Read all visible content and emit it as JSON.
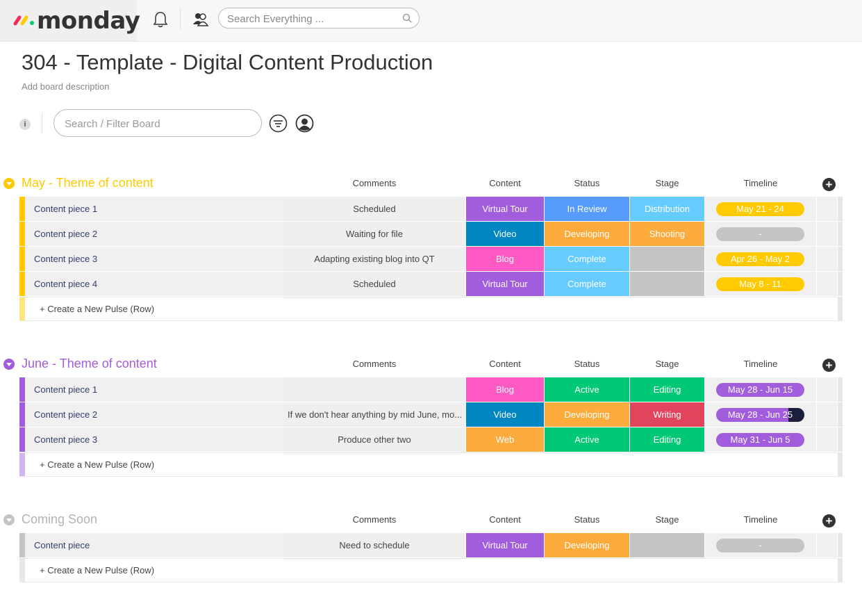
{
  "app": {
    "logo_text": "monday"
  },
  "topbar": {
    "search_placeholder": "Search Everything ..."
  },
  "board": {
    "title": "304 - Template - Digital Content Production",
    "description": "Add board description",
    "info_label": "i",
    "filter_placeholder": "Search / Filter Board"
  },
  "columns": {
    "comments": "Comments",
    "content": "Content",
    "status": "Status",
    "stage": "Stage",
    "timeline": "Timeline"
  },
  "create_row_label": "+ Create a New Pulse (Row)",
  "groups": [
    {
      "title": "May - Theme of content",
      "color": "#ffcb00",
      "rows": [
        {
          "name": "Content piece 1",
          "comment": "Scheduled",
          "content": "Virtual Tour",
          "content_color": "#a25ddc",
          "status": "In Review",
          "status_color": "#579bfc",
          "stage": "Distribution",
          "stage_color": "#66ccff",
          "timeline": "May 21 - 24",
          "timeline_color": "#ffcb00"
        },
        {
          "name": "Content piece 2",
          "comment": "Waiting for file",
          "content": "Video",
          "content_color": "#0086c0",
          "status": "Developing",
          "status_color": "#fdab3d",
          "stage": "Shooting",
          "stage_color": "#fdab3d",
          "timeline": "-",
          "timeline_color": "#c4c4c4"
        },
        {
          "name": "Content piece 3",
          "comment": "Adapting existing blog into QT",
          "content": "Blog",
          "content_color": "#ff5ac4",
          "status": "Complete",
          "status_color": "#66ccff",
          "stage": "",
          "stage_color": "#c4c4c4",
          "timeline": "Apr 26 - May 2",
          "timeline_color": "#ffcb00"
        },
        {
          "name": "Content piece 4",
          "comment": "Scheduled",
          "content": "Virtual Tour",
          "content_color": "#a25ddc",
          "status": "Complete",
          "status_color": "#66ccff",
          "stage": "",
          "stage_color": "#c4c4c4",
          "timeline": "May 8 - 11",
          "timeline_color": "#ffcb00"
        }
      ]
    },
    {
      "title": "June - Theme of content",
      "color": "#a25ddc",
      "rows": [
        {
          "name": "Content piece 1",
          "comment": "",
          "content": "Blog",
          "content_color": "#ff5ac4",
          "status": "Active",
          "status_color": "#00c875",
          "stage": "Editing",
          "stage_color": "#00c875",
          "timeline": "May 28 - Jun 15",
          "timeline_color": "#a25ddc"
        },
        {
          "name": "Content piece 2",
          "comment": "If we don't hear anything by mid June, mo...",
          "content": "Video",
          "content_color": "#0086c0",
          "status": "Developing",
          "status_color": "#fdab3d",
          "stage": "Writing",
          "stage_color": "#e2445c",
          "timeline": "May 28 - Jun 25",
          "timeline_color": "#a25ddc"
        },
        {
          "name": "Content piece 3",
          "comment": "Produce other two",
          "content": "Web",
          "content_color": "#fdab3d",
          "status": "Active",
          "status_color": "#00c875",
          "stage": "Editing",
          "stage_color": "#00c875",
          "timeline": "May 31 - Jun 5",
          "timeline_color": "#a25ddc"
        }
      ]
    },
    {
      "title": "Coming Soon",
      "color": "#c4c4c4",
      "rows": [
        {
          "name": "Content piece",
          "comment": "Need to schedule",
          "content": "Virtual Tour",
          "content_color": "#a25ddc",
          "status": "Developing",
          "status_color": "#fdab3d",
          "stage": "",
          "stage_color": "#c4c4c4",
          "timeline": "-",
          "timeline_color": "#c4c4c4"
        }
      ]
    }
  ]
}
